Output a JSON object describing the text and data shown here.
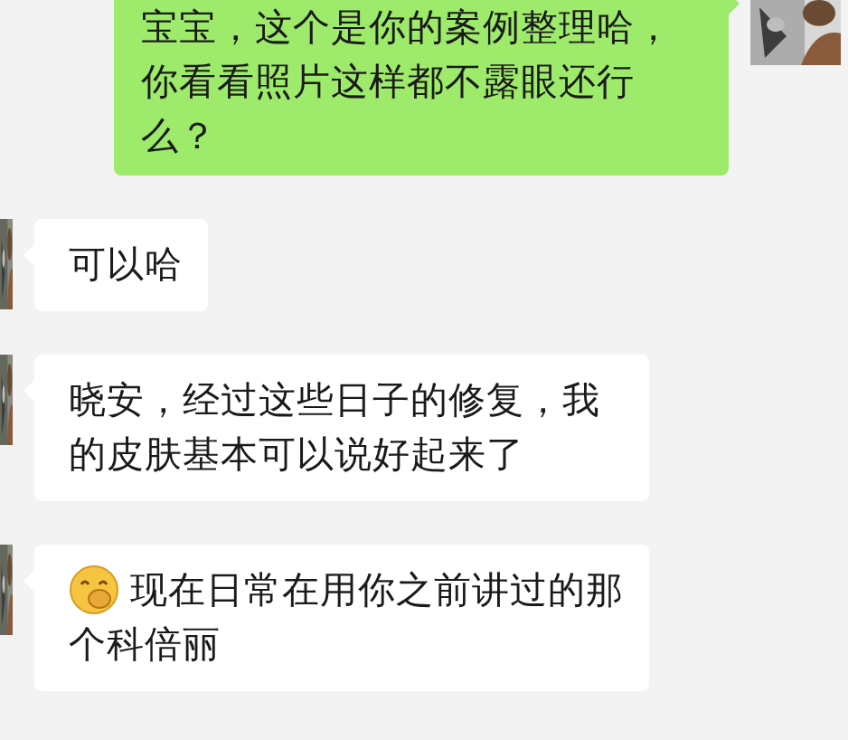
{
  "messages": [
    {
      "kind": "outgoing",
      "text": "宝宝，这个是你的案例整理哈，你看看照片这样都不露眼还行么？",
      "has_emoji": false
    },
    {
      "kind": "incoming",
      "text": "可以哈",
      "has_emoji": false
    },
    {
      "kind": "incoming",
      "text": "晓安，经过这些日子的修复，我的皮肤基本可以说好起来了",
      "has_emoji": false
    },
    {
      "kind": "incoming",
      "text": "现在日常在用你之前讲过的那个科倍丽",
      "has_emoji": true
    }
  ]
}
